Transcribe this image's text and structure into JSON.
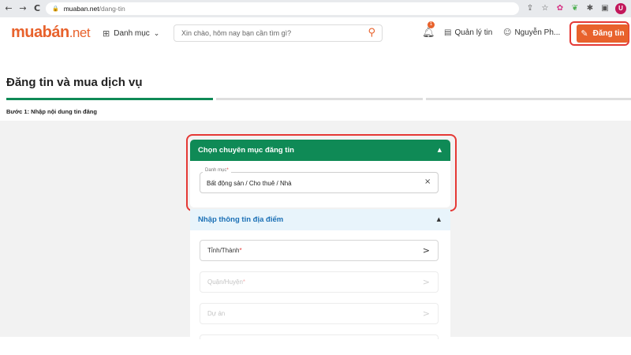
{
  "browser": {
    "back": "←",
    "forward": "→",
    "reload": "C",
    "url_host": "muaban.net",
    "url_path": "/dang-tin",
    "profile_initial": "U"
  },
  "header": {
    "logo_main": "muabán",
    "logo_suffix": ".net",
    "category_label": "Danh mục",
    "search_placeholder": "Xin chào, hôm nay bạn cần tìm gì?",
    "notification_count": "1",
    "manage_label": "Quản lý tin",
    "user_name": "Nguyễn Ph...",
    "post_button_label": "Đăng tin"
  },
  "page": {
    "title": "Đăng tin và mua dịch vụ",
    "step_label": "Bước 1:  Nhập nội dung tin đăng",
    "progress_step": 1,
    "progress_total": 3
  },
  "category_section": {
    "header": "Chọn chuyên mục đăng tin",
    "field_label": "Danh mục",
    "field_required_mark": "*",
    "field_value": "Bất động sản / Cho thuê / Nhà",
    "clear_symbol": "×"
  },
  "location_section": {
    "header": "Nhập thông tin địa điểm",
    "province_label": "Tỉnh/Thành",
    "district_label": "Quận/Huyện",
    "project_label": "Dự án",
    "required_mark": "*",
    "arrow": ">"
  },
  "colors": {
    "brand": "#e8622c",
    "primary_green": "#0f8a56",
    "highlight": "#e53935",
    "link_blue": "#1a6fb5"
  }
}
